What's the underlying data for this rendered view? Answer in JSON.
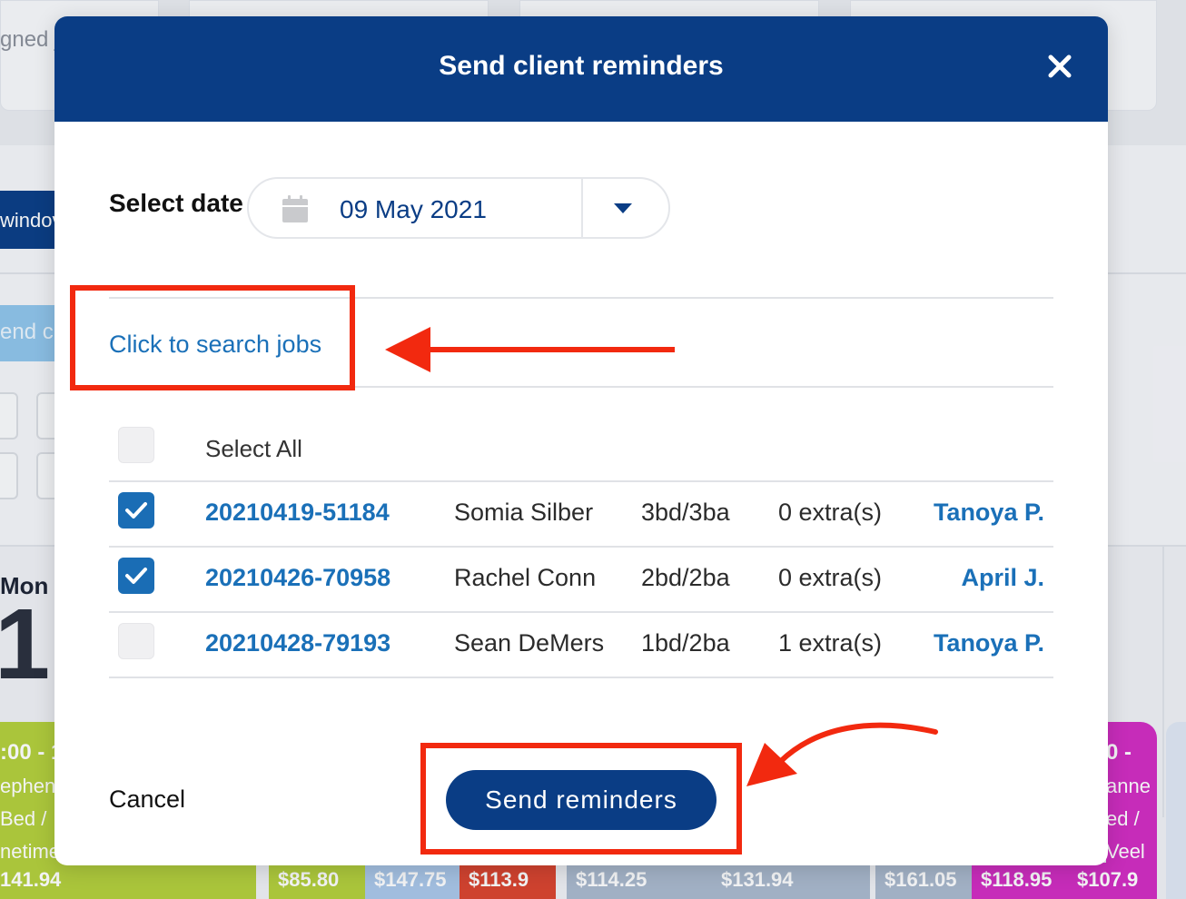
{
  "background": {
    "assigned_fragment": "gned j",
    "window_button_fragment": "windov",
    "send_button_fragment": "end c",
    "day_name_fragment": "Mon",
    "day_number_fragment": "1",
    "left_event": {
      "time_fragment": ":00 - 1",
      "name_fragment": "ephen",
      "bed_fragment": "Bed /",
      "freq_fragment": "netime"
    },
    "right_event": {
      "time_fragment": "0 -",
      "name_fragment": "anne",
      "bed_fragment": "ed /",
      "freq_fragment": "Veel"
    },
    "prices": [
      {
        "label": "141.94",
        "color": "#b3cf3b"
      },
      {
        "label": "$85.80",
        "color": "#b3cf3b"
      },
      {
        "label": "$147.75",
        "color": "#a9c6e8"
      },
      {
        "label": "$113.9",
        "color": "#d9432e"
      },
      {
        "label": "$114.25",
        "color": "#a9b8cc"
      },
      {
        "label": "$131.94",
        "color": "#a9b8cc"
      },
      {
        "label": "$161.05",
        "color": "#a9b8cc"
      },
      {
        "label": "$118.95",
        "color": "#d12cc1"
      },
      {
        "label": "$107.9",
        "color": "#d12cc1"
      }
    ]
  },
  "modal": {
    "title": "Send client reminders",
    "close_icon": "close-icon",
    "select_date_label": "Select date",
    "date_value": "09 May 2021",
    "calendar_icon": "calendar-icon",
    "dropdown_icon": "caret-down-icon",
    "search_link": "Click to search jobs",
    "select_all_label": "Select All",
    "select_all_checked": false,
    "jobs": [
      {
        "id": "20210419-51184",
        "client": "Somia Silber",
        "size": "3bd/3ba",
        "extras": "0 extra(s)",
        "assignee": "Tanoya P.",
        "checked": true
      },
      {
        "id": "20210426-70958",
        "client": "Rachel Conn",
        "size": "2bd/2ba",
        "extras": "0 extra(s)",
        "assignee": "April J.",
        "checked": true
      },
      {
        "id": "20210428-79193",
        "client": "Sean DeMers",
        "size": "1bd/2ba",
        "extras": "1 extra(s)",
        "assignee": "Tanoya P.",
        "checked": false
      }
    ],
    "cancel_label": "Cancel",
    "send_label": "Send reminders"
  },
  "colors": {
    "brand_navy": "#0a3d85",
    "link_blue": "#1a70b8",
    "checkbox_blue": "#1a6db5",
    "annotation_red": "#f2290f"
  }
}
